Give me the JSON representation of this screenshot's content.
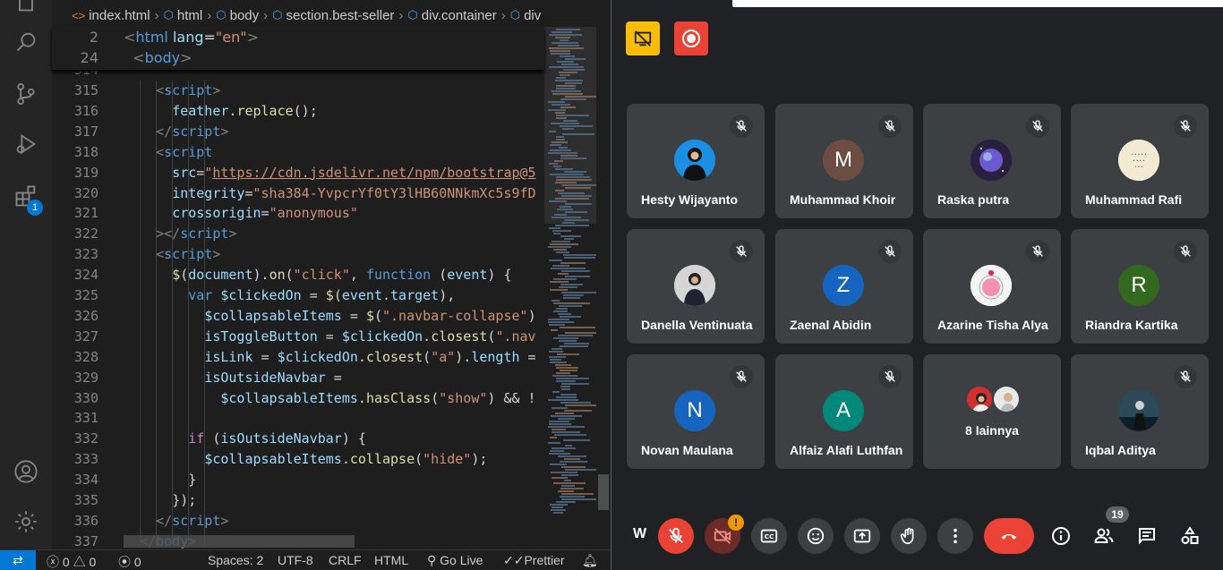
{
  "editor": {
    "breadcrumb": [
      "index.html",
      "html",
      "body",
      "section.best-seller",
      "div.container",
      "div"
    ],
    "sticky_lines": [
      {
        "num": "2",
        "html": "<span class='t-br'>&lt;</span><span class='t-tag'>html</span> <span class='t-attr'>lang</span><span class='t-p'>=</span><span class='t-str'>\"en\"</span><span class='t-br'>&gt;</span>"
      },
      {
        "num": "24",
        "html": "  <span class='t-br'>&lt;</span><span class='t-tag'>body</span><span class='t-br'>&gt;</span>"
      }
    ],
    "lines": [
      {
        "num": "314",
        "html": ""
      },
      {
        "num": "315",
        "html": "    <span class='t-br'>&lt;</span><span class='t-tag'>script</span><span class='t-br'>&gt;</span>"
      },
      {
        "num": "316",
        "html": "      <span class='t-var'>feather</span><span class='t-p'>.</span><span class='t-fn'>replace</span><span class='t-p'>();</span>"
      },
      {
        "num": "317",
        "html": "    <span class='t-br'>&lt;/</span><span class='t-tag'>script</span><span class='t-br'>&gt;</span>"
      },
      {
        "num": "318",
        "html": "    <span class='t-br'>&lt;</span><span class='t-tag'>script</span>"
      },
      {
        "num": "319",
        "html": "      <span class='t-attr'>src</span><span class='t-p'>=</span><span class='t-str'>\"<u>https://cdn.jsdelivr.net/npm/bootstrap@5</u></span>"
      },
      {
        "num": "320",
        "html": "      <span class='t-attr'>integrity</span><span class='t-p'>=</span><span class='t-str'>\"sha384-YvpcrYf0tY3lHB60NNkmXc5s9fD</span>"
      },
      {
        "num": "321",
        "html": "      <span class='t-attr'>crossorigin</span><span class='t-p'>=</span><span class='t-str'>\"anonymous\"</span>"
      },
      {
        "num": "322",
        "html": "    <span class='t-br'>&gt;&lt;/</span><span class='t-tag'>script</span><span class='t-br'>&gt;</span>"
      },
      {
        "num": "323",
        "html": "    <span class='t-br'>&lt;</span><span class='t-tag'>script</span><span class='t-br'>&gt;</span>"
      },
      {
        "num": "324",
        "html": "      <span class='t-fn'>$</span><span class='t-p'>(</span><span class='t-var'>document</span><span class='t-p'>).</span><span class='t-fn'>on</span><span class='t-p'>(</span><span class='t-str'>\"click\"</span><span class='t-p'>, </span><span class='t-kw'>function</span><span class='t-p'> (</span><span class='t-var'>event</span><span class='t-p'>) {</span>"
      },
      {
        "num": "325",
        "html": "        <span class='t-kw'>var</span> <span class='t-var'>$clickedOn</span><span class='t-p'> = </span><span class='t-fn'>$</span><span class='t-p'>(</span><span class='t-var'>event</span><span class='t-p'>.</span><span class='t-var'>target</span><span class='t-p'>),</span>"
      },
      {
        "num": "326",
        "html": "          <span class='t-var'>$collapsableItems</span><span class='t-p'> = </span><span class='t-fn'>$</span><span class='t-p'>(</span><span class='t-str'>\".navbar-collapse\"</span><span class='t-p'>)</span>"
      },
      {
        "num": "327",
        "html": "          <span class='t-var'>isToggleButton</span><span class='t-p'> = </span><span class='t-var'>$clickedOn</span><span class='t-p'>.</span><span class='t-fn'>closest</span><span class='t-p'>(</span><span class='t-str'>\".nav</span>"
      },
      {
        "num": "328",
        "html": "          <span class='t-var'>isLink</span><span class='t-p'> = </span><span class='t-var'>$clickedOn</span><span class='t-p'>.</span><span class='t-fn'>closest</span><span class='t-p'>(</span><span class='t-str'>\"a\"</span><span class='t-p'>).</span><span class='t-var'>length</span><span class='t-p'> =</span>"
      },
      {
        "num": "329",
        "html": "          <span class='t-var'>isOutsideNavbar</span><span class='t-p'> =</span>"
      },
      {
        "num": "330",
        "html": "            <span class='t-var'>$collapsableItems</span><span class='t-p'>.</span><span class='t-fn'>hasClass</span><span class='t-p'>(</span><span class='t-str'>\"show\"</span><span class='t-p'>) &amp;&amp; !</span>"
      },
      {
        "num": "331",
        "html": ""
      },
      {
        "num": "332",
        "html": "        <span class='t-cf'>if</span><span class='t-p'> (</span><span class='t-var'>isOutsideNavbar</span><span class='t-p'>) {</span>"
      },
      {
        "num": "333",
        "html": "          <span class='t-var'>$collapsableItems</span><span class='t-p'>.</span><span class='t-fn'>collapse</span><span class='t-p'>(</span><span class='t-str'>\"hide\"</span><span class='t-p'>);</span>"
      },
      {
        "num": "334",
        "html": "        <span class='t-p'>}</span>"
      },
      {
        "num": "335",
        "html": "      <span class='t-p'>});</span>"
      },
      {
        "num": "336",
        "html": "    <span class='t-br'>&lt;/</span><span class='t-tag'>script</span><span class='t-br'>&gt;</span>"
      },
      {
        "num": "337",
        "html": "  <span class='t-br'>&lt;/</span><span class='t-tag'>body</span><span class='t-br'>&gt;</span>"
      }
    ],
    "extensions_badge": "1"
  },
  "statusbar": {
    "errors": "0",
    "warnings": "0",
    "ports": "0",
    "spaces": "Spaces: 2",
    "encoding": "UTF-8",
    "eol": "CRLF",
    "language": "HTML",
    "golive": "Go Live",
    "prettier": "Prettier"
  },
  "meet": {
    "participants": [
      {
        "name": "Hesty Wijayanto",
        "initial": "",
        "color": "#1a73e8",
        "photo": "person-blue"
      },
      {
        "name": "Muhammad Khoir",
        "initial": "M",
        "color": "#6d4c41",
        "photo": ""
      },
      {
        "name": "Raska putra",
        "initial": "",
        "color": "#1b1b2f",
        "photo": "planet"
      },
      {
        "name": "Muhammad Rafi",
        "initial": "",
        "color": "#f3ead3",
        "photo": "logo-text"
      },
      {
        "name": "Danella Ventinuata",
        "initial": "",
        "color": "#c8c8c8",
        "photo": "person-gray"
      },
      {
        "name": "Zaenal Abidin",
        "initial": "Z",
        "color": "#1565c0",
        "photo": ""
      },
      {
        "name": "Azarine Tisha Alya",
        "initial": "",
        "color": "#f8f8f8",
        "photo": "pink-art"
      },
      {
        "name": "Riandra Kartika",
        "initial": "R",
        "color": "#33691e",
        "photo": ""
      },
      {
        "name": "Novan Maulana",
        "initial": "N",
        "color": "#1565c0",
        "photo": ""
      },
      {
        "name": "Alfaiz Alafi Luthfan",
        "initial": "A",
        "color": "#00897b",
        "photo": ""
      },
      {
        "name": "8 lainnya",
        "initial": "",
        "color": "",
        "photo": "group"
      },
      {
        "name": "Iqbal Aditya",
        "initial": "",
        "color": "#1f3a4a",
        "photo": "person-dark"
      }
    ],
    "self_label": "W",
    "people_count": "19",
    "colors": {
      "bg": "#202124",
      "tile": "#3c4043",
      "end_call": "#ea4335",
      "present_warning": "#fbbc04"
    }
  }
}
